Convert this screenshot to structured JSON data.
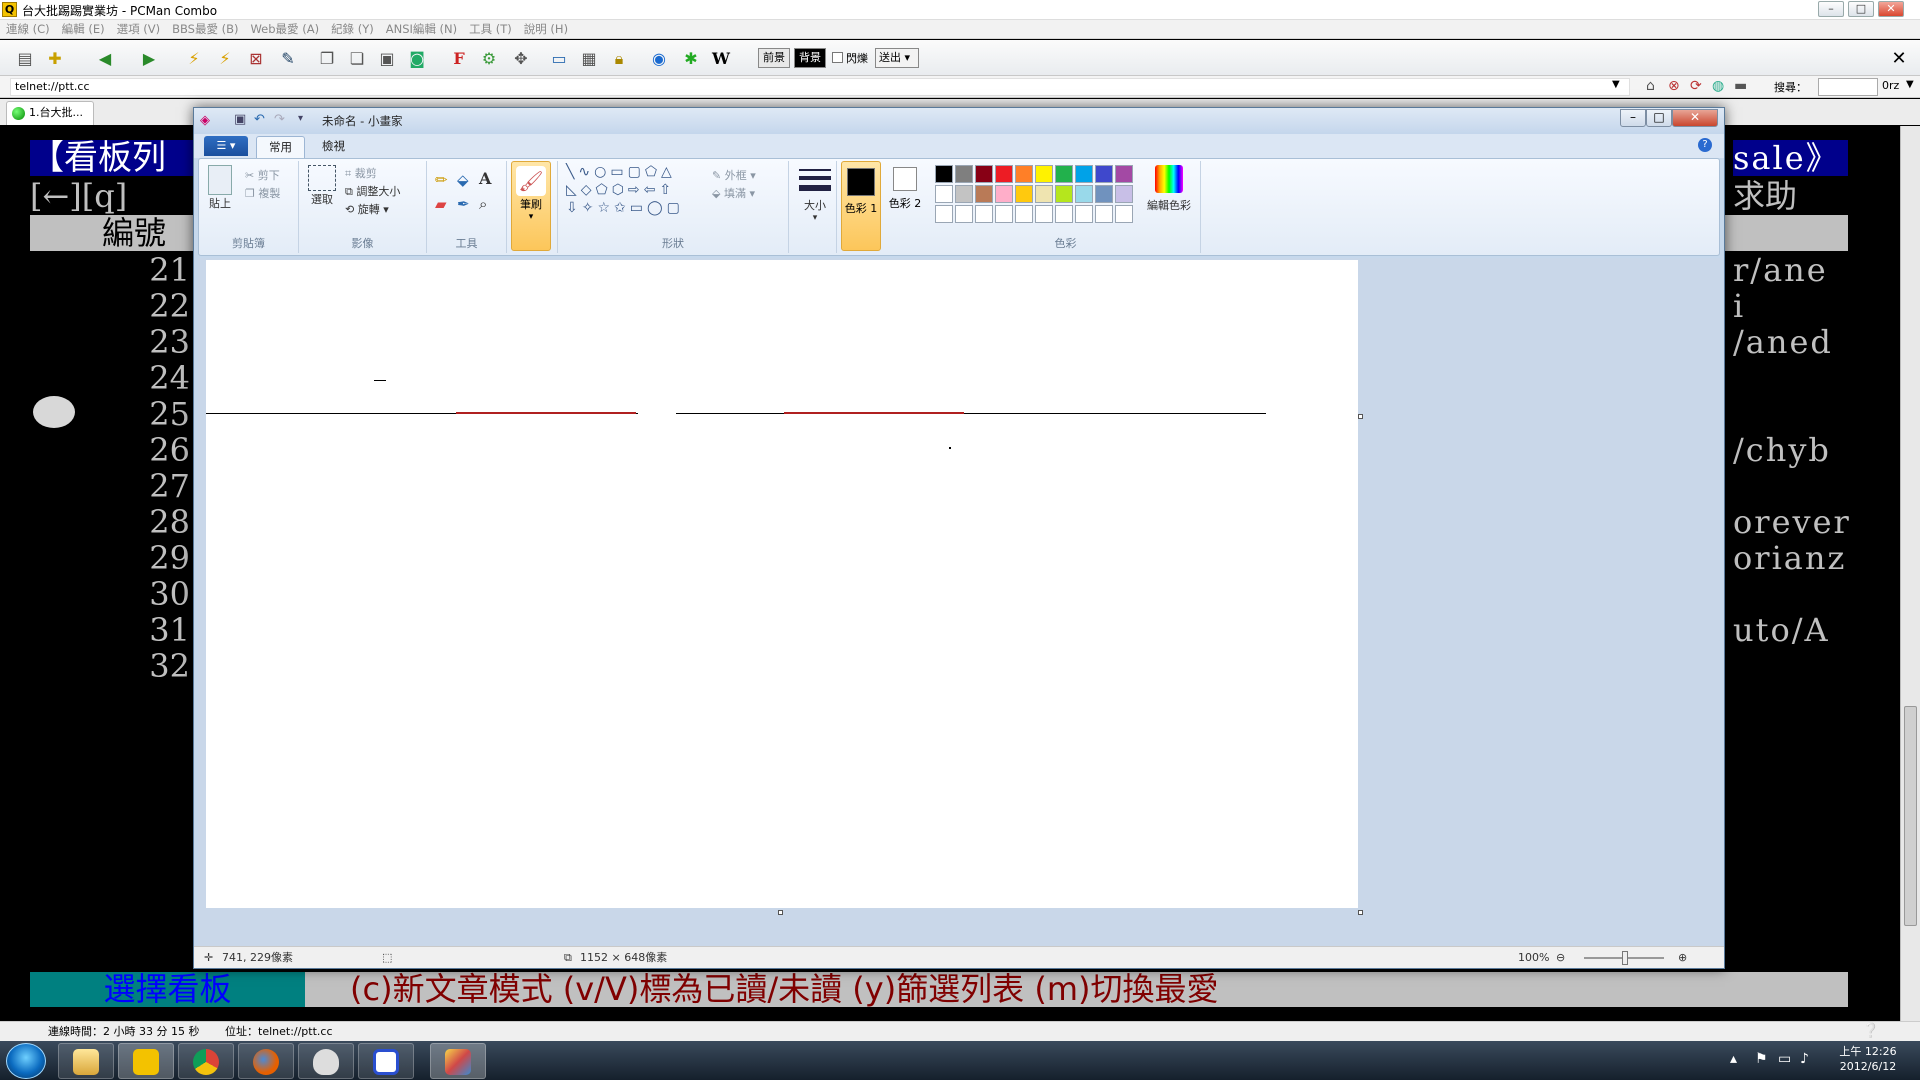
{
  "pcman": {
    "title": "台大批踢踢實業坊 - PCMan Combo",
    "menu": [
      "連線 (C)",
      "編輯 (E)",
      "選項 (V)",
      "BBS最愛 (B)",
      "Web最愛 (A)",
      "紀錄 (Y)",
      "ANSI編輯 (N)",
      "工具 (T)",
      "說明 (H)"
    ],
    "toolbar": {
      "fg_label": "前景",
      "bg_label": "背景",
      "blink_label": "閃爍",
      "send_label": "送出",
      "font_icon": "F",
      "wiki_icon": "W"
    },
    "address": "telnet://ptt.cc",
    "search_label": "搜尋：",
    "search_engine": "0rz",
    "tab_label": "1.台大批...",
    "statusbar": {
      "uptime": "連線時間：2 小時 33 分 15 秒",
      "location": "位址：telnet://ptt.cc"
    }
  },
  "terminal": {
    "header_left": "【看板列",
    "header_right": "sale》",
    "line2_left": "[←][q]",
    "line2_right": "求助",
    "line3_left": "編號",
    "row_numbers": [
      "21",
      "22",
      "23",
      "24",
      "25",
      "26",
      "27",
      "28",
      "29",
      "30",
      "31",
      "32"
    ],
    "right_fragments": [
      "r/ane",
      "i",
      "/aned",
      "",
      "",
      "/chyb",
      "",
      "orever",
      "orianz",
      "",
      "uto/A",
      ""
    ],
    "bottom_select": "選擇看板",
    "bottom_help": "(c)新文章模式 (v/V)標為已讀/未讀 (y)篩選列表 (m)切換最愛"
  },
  "paint": {
    "title": "未命名 - 小畫家",
    "tabs": [
      "常用",
      "檢視"
    ],
    "clipboard": {
      "paste": "貼上",
      "cut": "剪下",
      "copy": "複製",
      "group": "剪貼簿"
    },
    "image": {
      "select": "選取",
      "crop": "裁剪",
      "resize": "調整大小",
      "rotate": "旋轉",
      "group": "影像"
    },
    "tools": {
      "group": "工具"
    },
    "brushes": "筆刷",
    "shapes": {
      "outline": "外框",
      "fill": "填滿",
      "group": "形狀"
    },
    "size": "大小",
    "color1": "色彩 1",
    "color2": "色彩 2",
    "edit_colors": "編輯色彩",
    "colors_group": "色彩",
    "palette_row1": [
      "#000000",
      "#7f7f7f",
      "#880015",
      "#ed1c24",
      "#ff7f27",
      "#fff200",
      "#22b14c",
      "#00a2e8",
      "#3f48cc",
      "#a349a4"
    ],
    "palette_row2": [
      "#ffffff",
      "#c3c3c3",
      "#b97a57",
      "#ffaec9",
      "#ffc90e",
      "#efe4b0",
      "#b5e61d",
      "#99d9ea",
      "#7092be",
      "#c8bfe7"
    ],
    "status": {
      "cursor": "741, 229像素",
      "size": "1152 × 648像素",
      "zoom": "100%"
    }
  },
  "taskbar": {
    "time": "上午 12:26",
    "date": "2012/6/12"
  }
}
